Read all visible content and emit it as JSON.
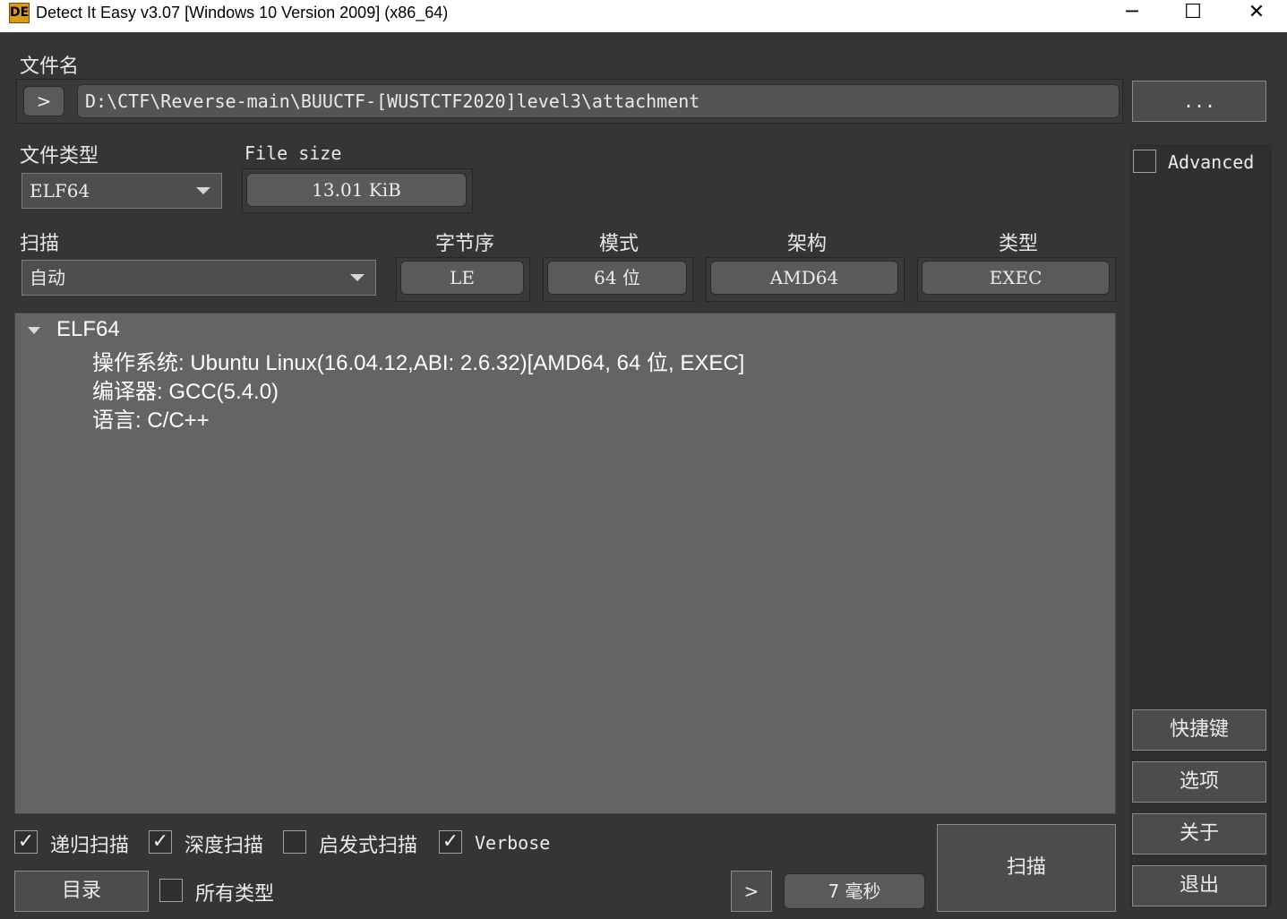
{
  "window": {
    "logo_text": "DE",
    "title": "Detect It Easy v3.07 [Windows 10 Version 2009] (x86_64)",
    "minimize_glyph": "─",
    "maximize_glyph": "☐",
    "close_glyph": "✕"
  },
  "file": {
    "label": "文件名",
    "expand_glyph": ">",
    "path": "D:\\CTF\\Reverse-main\\BUUCTF-[WUSTCTF2020]level3\\attachment",
    "browse_label": "..."
  },
  "filetype": {
    "label": "文件类型",
    "selected": "ELF64"
  },
  "filesize": {
    "label": "File size",
    "value": "13.01 KiB"
  },
  "scan_mode": {
    "label": "扫描",
    "selected": "自动"
  },
  "info": {
    "endian_label": "字节序",
    "endian_value": "LE",
    "mode_label": "模式",
    "mode_value": "64 位",
    "arch_label": "架构",
    "arch_value": "AMD64",
    "type_label": "类型",
    "type_value": "EXEC"
  },
  "advanced": {
    "label": "Advanced",
    "checked": false
  },
  "results": {
    "root": "ELF64",
    "lines": [
      "操作系统: Ubuntu Linux(16.04.12,ABI: 2.6.32)[AMD64, 64 位, EXEC]",
      "编译器: GCC(5.4.0)",
      "语言: C/C++"
    ]
  },
  "options": {
    "recursive": {
      "label": "递归扫描",
      "checked": true
    },
    "deep": {
      "label": "深度扫描",
      "checked": true
    },
    "heuristic": {
      "label": "启发式扫描",
      "checked": false
    },
    "verbose": {
      "label": "Verbose",
      "checked": true
    },
    "all_types": {
      "label": "所有类型",
      "checked": false
    }
  },
  "bottom": {
    "directory_label": "目录",
    "next_glyph": ">",
    "elapsed": "7 毫秒",
    "scan_label": "扫描"
  },
  "side_buttons": {
    "shortcuts": "快捷键",
    "options": "选项",
    "about": "关于",
    "exit": "退出"
  },
  "check_glyph": "✓"
}
